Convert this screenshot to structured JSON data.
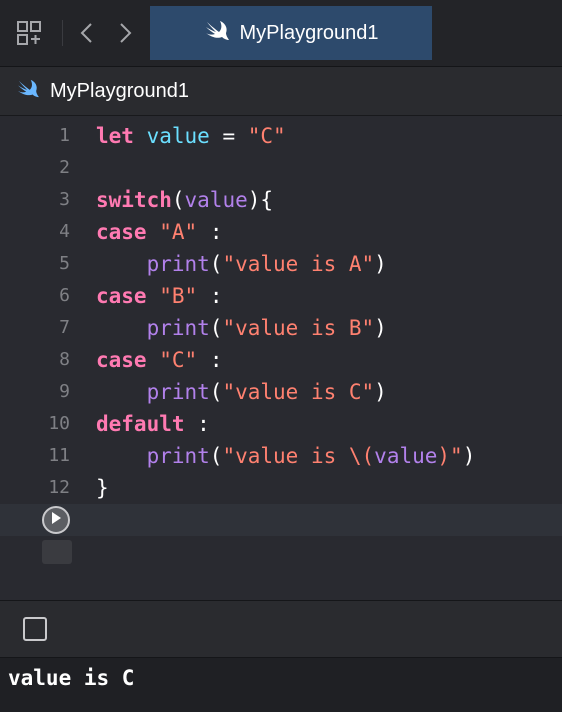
{
  "tab": {
    "title": "MyPlayground1"
  },
  "jumpbar": {
    "title": "MyPlayground1"
  },
  "code_lines": [
    {
      "num": "1",
      "tokens": [
        [
          "kw",
          "let"
        ],
        [
          "t",
          " "
        ],
        [
          "var",
          "value"
        ],
        [
          "t",
          " = "
        ],
        [
          "str",
          "\"C\""
        ]
      ]
    },
    {
      "num": "2",
      "tokens": []
    },
    {
      "num": "3",
      "tokens": [
        [
          "kw",
          "switch"
        ],
        [
          "t",
          "("
        ],
        [
          "pl",
          "value"
        ],
        [
          "t",
          "){"
        ]
      ]
    },
    {
      "num": "4",
      "tokens": [
        [
          "kw",
          "case"
        ],
        [
          "t",
          " "
        ],
        [
          "str",
          "\"A\""
        ],
        [
          "t",
          " :"
        ]
      ]
    },
    {
      "num": "5",
      "tokens": [
        [
          "t",
          "    "
        ],
        [
          "pl",
          "print"
        ],
        [
          "t",
          "("
        ],
        [
          "str",
          "\"value is A\""
        ],
        [
          "t",
          ")"
        ]
      ]
    },
    {
      "num": "6",
      "tokens": [
        [
          "kw",
          "case"
        ],
        [
          "t",
          " "
        ],
        [
          "str",
          "\"B\""
        ],
        [
          "t",
          " :"
        ]
      ]
    },
    {
      "num": "7",
      "tokens": [
        [
          "t",
          "    "
        ],
        [
          "pl",
          "print"
        ],
        [
          "t",
          "("
        ],
        [
          "str",
          "\"value is B\""
        ],
        [
          "t",
          ")"
        ]
      ]
    },
    {
      "num": "8",
      "tokens": [
        [
          "kw",
          "case"
        ],
        [
          "t",
          " "
        ],
        [
          "str",
          "\"C\""
        ],
        [
          "t",
          " :"
        ]
      ]
    },
    {
      "num": "9",
      "tokens": [
        [
          "t",
          "    "
        ],
        [
          "pl",
          "print"
        ],
        [
          "t",
          "("
        ],
        [
          "str",
          "\"value is C\""
        ],
        [
          "t",
          ")"
        ]
      ]
    },
    {
      "num": "10",
      "tokens": [
        [
          "kw",
          "default"
        ],
        [
          "t",
          " :"
        ]
      ]
    },
    {
      "num": "11",
      "tokens": [
        [
          "t",
          "    "
        ],
        [
          "pl",
          "print"
        ],
        [
          "t",
          "("
        ],
        [
          "str",
          "\"value is \\("
        ],
        [
          "pl",
          "value"
        ],
        [
          "str",
          ")\""
        ],
        [
          "t",
          ")"
        ]
      ]
    },
    {
      "num": "12",
      "tokens": [
        [
          "t",
          "}"
        ]
      ]
    }
  ],
  "console": {
    "output": "value is C"
  },
  "icons": {
    "grid": "grid-icon",
    "back": "chevron-left-icon",
    "forward": "chevron-right-icon",
    "swift": "swift-icon",
    "run": "play-icon",
    "console_toggle": "square-icon"
  },
  "colors": {
    "keyword": "#ff7ab2",
    "string": "#ff8170",
    "variable": "#6bdfff",
    "function": "#b281eb",
    "active_tab": "#2d4a6c"
  }
}
